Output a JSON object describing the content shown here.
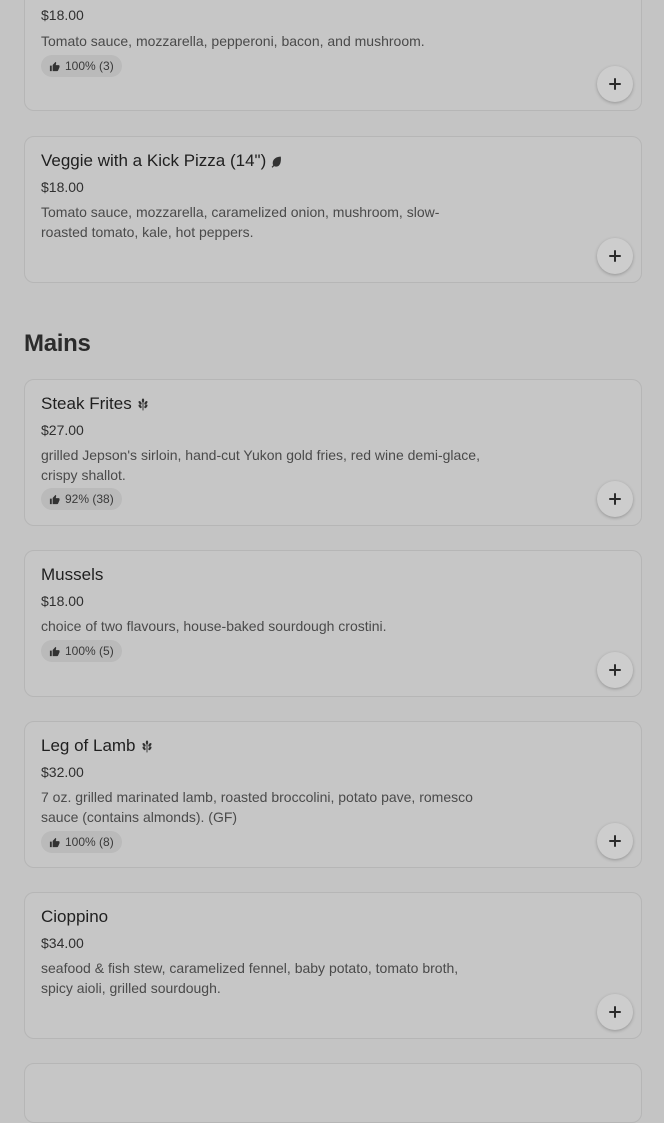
{
  "items": {
    "pizza_partial": {
      "price": "$18.00",
      "description": "Tomato sauce, mozzarella, pepperoni, bacon, and mushroom.",
      "rating": "100% (3)"
    },
    "veggie_pizza": {
      "name": "Veggie with a Kick Pizza (14\")",
      "price": "$18.00",
      "description": "Tomato sauce, mozzarella, caramelized onion, mushroom, slow-roasted tomato, kale, hot peppers.",
      "icon": "leaf-icon"
    },
    "steak_frites": {
      "name": "Steak Frites",
      "price": "$27.00",
      "description": "grilled Jepson's sirloin, hand-cut Yukon gold fries, red wine demi-glace, crispy shallot.",
      "rating": "92% (38)",
      "icon": "wheat-icon"
    },
    "mussels": {
      "name": "Mussels",
      "price": "$18.00",
      "description": "choice of two flavours, house-baked sourdough crostini.",
      "rating": "100% (5)"
    },
    "leg_of_lamb": {
      "name": "Leg of Lamb",
      "price": "$32.00",
      "description": "7 oz. grilled marinated lamb, roasted broccolini, potato pave, romesco sauce (contains almonds). (GF)",
      "rating": "100% (8)",
      "icon": "wheat-icon"
    },
    "cioppino": {
      "name": "Cioppino",
      "price": "$34.00",
      "description": "seafood & fish stew, caramelized fennel, baby potato, tomato broth, spicy aioli, grilled sourdough."
    }
  },
  "sections": {
    "mains": "Mains"
  },
  "icons": {
    "thumb": "thumbs-up-icon",
    "add": "plus-icon"
  }
}
